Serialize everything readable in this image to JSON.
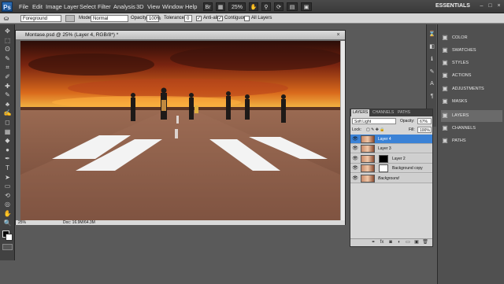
{
  "menubar": {
    "logo": "Ps",
    "items": [
      "File",
      "Edit",
      "Image",
      "Layer",
      "Select",
      "Filter",
      "Analysis",
      "3D",
      "View",
      "Window",
      "Help"
    ],
    "zoom": "25%",
    "workspace": "ESSENTIALS",
    "window_buttons": [
      "–",
      "□",
      "×"
    ]
  },
  "options": {
    "feather_value": "Foreground",
    "mode_label": "Mode:",
    "mode_value": "Normal",
    "opacity_label": "Opacity:",
    "opacity_value": "100%",
    "tolerance_label": "Tolerance:",
    "tolerance_value": "0",
    "antialias_label": "Anti-alias",
    "contiguous_label": "Contiguous",
    "alllayers_label": "All Layers"
  },
  "toolbar": {
    "tools": [
      "move-tool",
      "marquee-tool",
      "lasso-tool",
      "quick-select-tool",
      "crop-tool",
      "eyedropper-tool",
      "healing-tool",
      "brush-tool",
      "clone-tool",
      "history-brush-tool",
      "eraser-tool",
      "gradient-tool",
      "blur-tool",
      "dodge-tool",
      "pen-tool",
      "type-tool",
      "path-select-tool",
      "shape-tool",
      "3d-rotate-tool",
      "3d-orbit-tool",
      "hand-tool",
      "zoom-tool"
    ],
    "glyphs": [
      "✥",
      "⬚",
      "ʘ",
      "✎",
      "⌗",
      "✐",
      "✚",
      "✎",
      "♣",
      "✍",
      "◻",
      "▦",
      "◆",
      "●",
      "✒",
      "T",
      "➤",
      "▭",
      "⟲",
      "◎",
      "✋",
      "🔍"
    ]
  },
  "document": {
    "title": "Montase.psd @ 25% (Layer 4, RGB/8*) *",
    "close": "×",
    "status_zoom": "25%",
    "status_doc": "Doc: 16.9M/64.3M"
  },
  "dock": {
    "groups": [
      {
        "label": "COLOR",
        "icon": "color-icon"
      },
      {
        "label": "SWATCHES",
        "icon": "swatches-icon"
      },
      {
        "label": "STYLES",
        "icon": "styles-icon"
      },
      {
        "label": "ACTIONS",
        "icon": "actions-icon"
      },
      {
        "label": "ADJUSTMENTS",
        "icon": "adjustments-icon"
      },
      {
        "label": "MASKS",
        "icon": "masks-icon"
      },
      {
        "label": "LAYERS",
        "icon": "layers-icon"
      },
      {
        "label": "CHANNELS",
        "icon": "channels-icon"
      },
      {
        "label": "PATHS",
        "icon": "paths-icon"
      }
    ]
  },
  "layers_panel": {
    "tabs": [
      "LAYERS",
      "CHANNELS",
      "PATHS"
    ],
    "blend_mode": "Soft Light",
    "opacity_label": "Opacity:",
    "opacity_value": "67%",
    "fill_label": "Fill:",
    "fill_value": "100%",
    "lock_label": "Lock:",
    "layers": [
      {
        "name": "Layer 4",
        "selected": true
      },
      {
        "name": "Layer 3",
        "selected": false
      },
      {
        "name": "Layer 2",
        "selected": false
      },
      {
        "name": "Background copy",
        "selected": false
      },
      {
        "name": "Background",
        "selected": false
      }
    ],
    "footer_icons": [
      "link-icon",
      "fx-icon",
      "mask-icon",
      "adjustment-icon",
      "group-icon",
      "new-layer-icon",
      "trash-icon"
    ]
  }
}
